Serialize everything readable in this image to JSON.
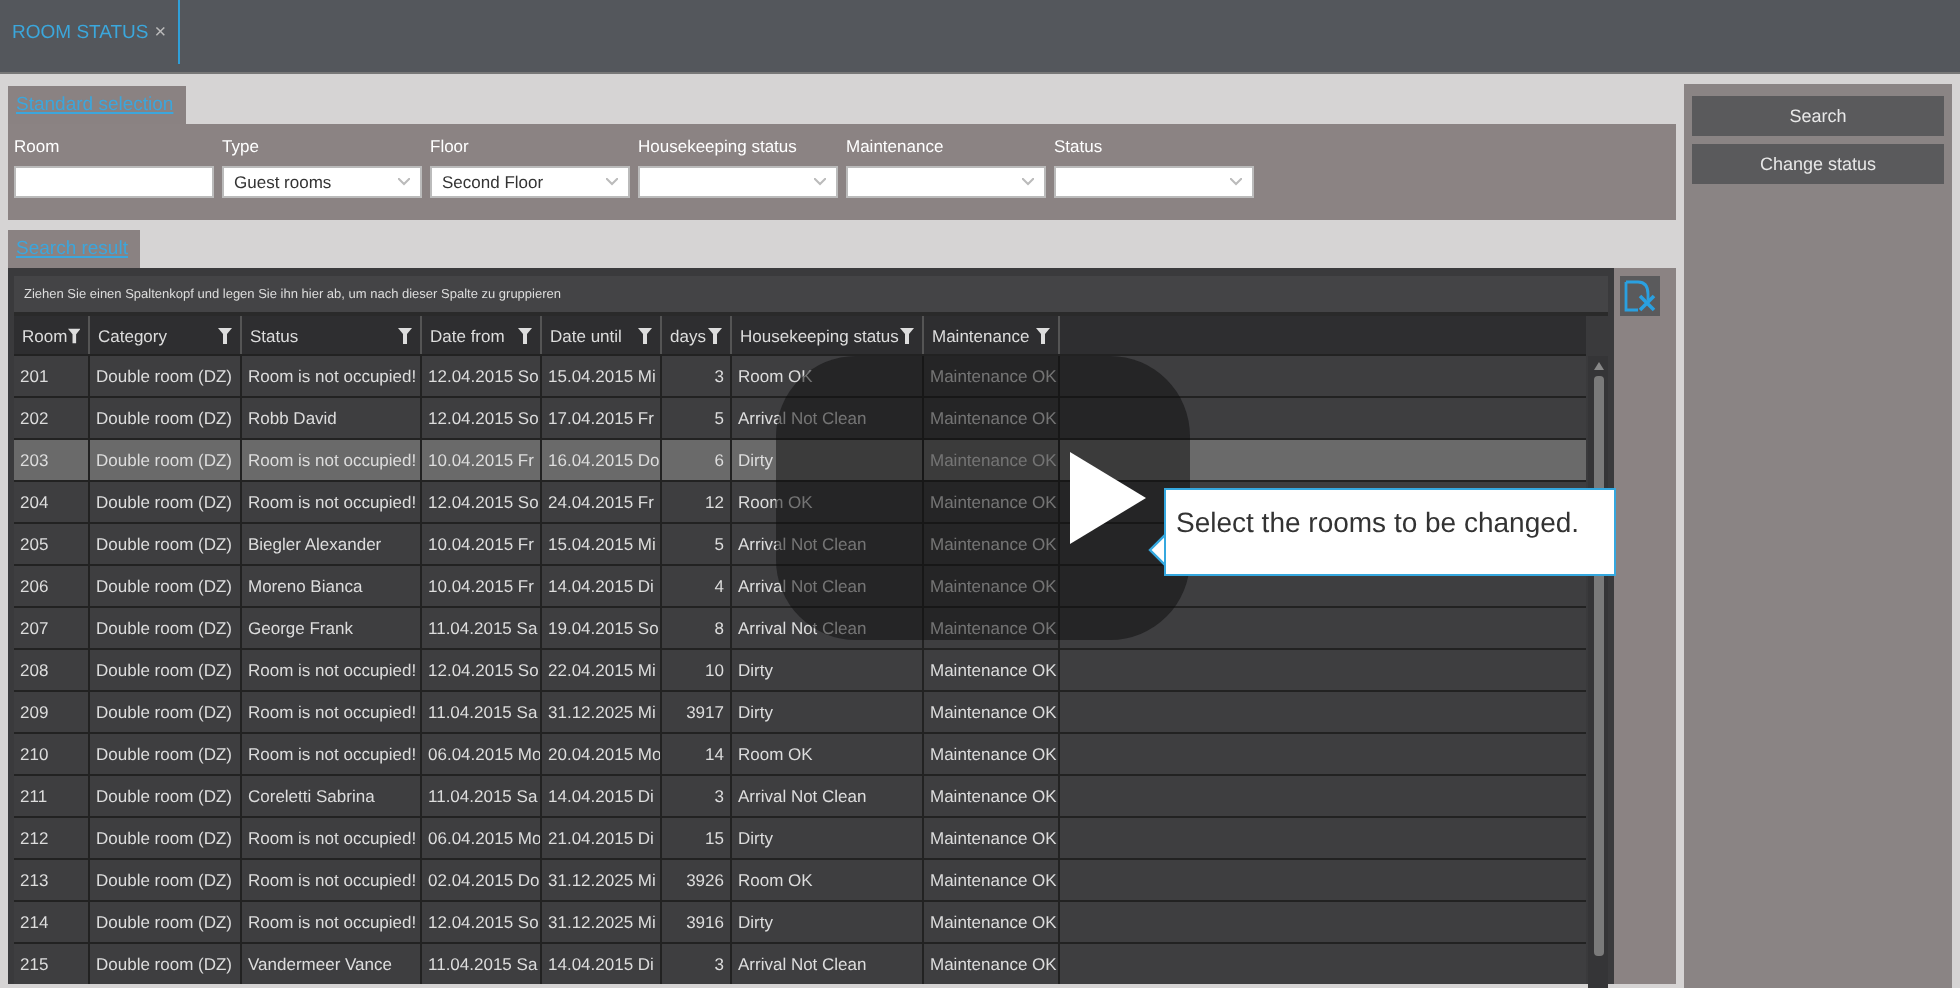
{
  "tabs": [
    {
      "label": "ROOM STATUS",
      "close": "×",
      "selected": true
    }
  ],
  "selection": {
    "tab": "Standard selection",
    "filters": [
      {
        "label": "Room",
        "kind": "text"
      },
      {
        "label": "Type",
        "kind": "dropdown",
        "value": "Guest rooms"
      },
      {
        "label": "Floor",
        "kind": "dropdown",
        "value": "Second Floor"
      },
      {
        "label": "Housekeeping status",
        "kind": "dropdown"
      },
      {
        "label": "Maintenance",
        "kind": "dropdown"
      },
      {
        "label": "Status",
        "kind": "dropdown"
      }
    ]
  },
  "actions": [
    "Search",
    "Change status"
  ],
  "results": {
    "tab": "Search result",
    "group_hint": "Ziehen Sie einen Spaltenkopf und legen Sie ihn hier ab, um nach dieser Spalte zu gruppieren",
    "columns": [
      "Room",
      "Category",
      "Status",
      "Date from",
      "Date until",
      "days",
      "Housekeeping status",
      "Maintenance"
    ],
    "rows": [
      {
        "selected": false,
        "cells": [
          "201",
          "Double room (DZ)",
          "Room is not occupied!",
          "12.04.2015 So",
          "15.04.2015 Mi",
          "3",
          "Room OK",
          "Maintenance OK"
        ]
      },
      {
        "selected": false,
        "cells": [
          "202",
          "Double room (DZ)",
          "Robb David",
          "12.04.2015 So",
          "17.04.2015 Fr",
          "5",
          "Arrival Not Clean",
          "Maintenance OK"
        ]
      },
      {
        "selected": true,
        "cells": [
          "203",
          "Double room (DZ)",
          "Room is not occupied!",
          "10.04.2015 Fr",
          "16.04.2015 Do",
          "6",
          "Dirty",
          "Maintenance OK"
        ]
      },
      {
        "selected": false,
        "cells": [
          "204",
          "Double room (DZ)",
          "Room is not occupied!",
          "12.04.2015 So",
          "24.04.2015 Fr",
          "12",
          "Room OK",
          "Maintenance OK"
        ]
      },
      {
        "selected": false,
        "cells": [
          "205",
          "Double room (DZ)",
          "Biegler Alexander",
          "10.04.2015 Fr",
          "15.04.2015 Mi",
          "5",
          "Arrival Not Clean",
          "Maintenance OK"
        ]
      },
      {
        "selected": false,
        "cells": [
          "206",
          "Double room (DZ)",
          "Moreno Bianca",
          "10.04.2015 Fr",
          "14.04.2015 Di",
          "4",
          "Arrival Not Clean",
          "Maintenance OK"
        ]
      },
      {
        "selected": false,
        "cells": [
          "207",
          "Double room (DZ)",
          "George Frank",
          "11.04.2015 Sa",
          "19.04.2015 So",
          "8",
          "Arrival Not Clean",
          "Maintenance OK"
        ]
      },
      {
        "selected": false,
        "cells": [
          "208",
          "Double room (DZ)",
          "Room is not occupied!",
          "12.04.2015 So",
          "22.04.2015 Mi",
          "10",
          "Dirty",
          "Maintenance OK"
        ]
      },
      {
        "selected": false,
        "cells": [
          "209",
          "Double room (DZ)",
          "Room is not occupied!",
          "11.04.2015 Sa",
          "31.12.2025 Mi",
          "3917",
          "Dirty",
          "Maintenance OK"
        ]
      },
      {
        "selected": false,
        "cells": [
          "210",
          "Double room (DZ)",
          "Room is not occupied!",
          "06.04.2015 Mo",
          "20.04.2015 Mo",
          "14",
          "Room OK",
          "Maintenance OK"
        ]
      },
      {
        "selected": false,
        "cells": [
          "211",
          "Double room (DZ)",
          "Coreletti Sabrina",
          "11.04.2015 Sa",
          "14.04.2015 Di",
          "3",
          "Arrival Not Clean",
          "Maintenance OK"
        ]
      },
      {
        "selected": false,
        "cells": [
          "212",
          "Double room (DZ)",
          "Room is not occupied!",
          "06.04.2015 Mo",
          "21.04.2015 Di",
          "15",
          "Dirty",
          "Maintenance OK"
        ]
      },
      {
        "selected": false,
        "cells": [
          "213",
          "Double room (DZ)",
          "Room is not occupied!",
          "02.04.2015 Do",
          "31.12.2025 Mi",
          "3926",
          "Room OK",
          "Maintenance OK"
        ]
      },
      {
        "selected": false,
        "cells": [
          "214",
          "Double room (DZ)",
          "Room is not occupied!",
          "12.04.2015 So",
          "31.12.2025 Mi",
          "3916",
          "Dirty",
          "Maintenance OK"
        ]
      },
      {
        "selected": false,
        "cells": [
          "215",
          "Double room (DZ)",
          "Vandermeer Vance",
          "11.04.2015 Sa",
          "14.04.2015 Di",
          "3",
          "Arrival Not Clean",
          "Maintenance OK"
        ]
      }
    ]
  },
  "tooltip": {
    "text": "Select the rooms to be changed."
  }
}
